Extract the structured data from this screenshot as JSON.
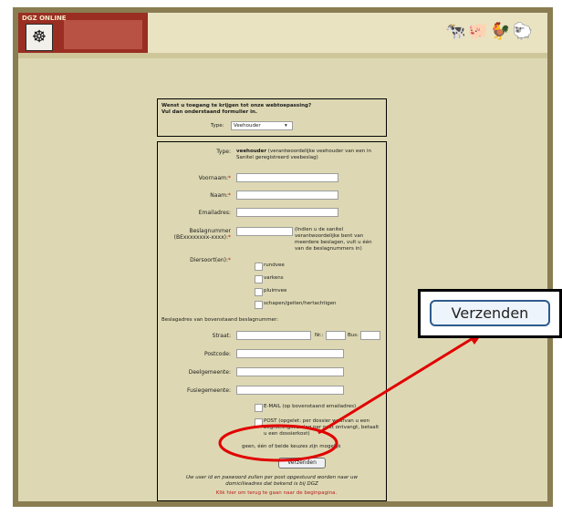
{
  "site": {
    "title": "DGZ ONLINE"
  },
  "intro": {
    "line1": "Wenst u toegang te krijgen tot onze webtoepassing?",
    "line2": "Vul dan onderstaand formulier in.",
    "type_label": "Type:",
    "type_value": "Veehouder"
  },
  "form": {
    "type_label": "Type:",
    "type_desc_bold": "veehouder",
    "type_desc": "(verantwoordelijke veehouder van een in Sanitel geregistreerd veebeslag)",
    "voornaam": "Voornaam:",
    "naam": "Naam:",
    "email": "Emailadres:",
    "beslagnummer": "Beslagnummer",
    "beslag_format": "(BExxxxxxxx-xxxx):",
    "beslag_hint": "(Indien u de sanitel verantwoordelijke bent van meerdere beslagen, vult u één van de beslagnummers in)",
    "diersoort": "Diersoort(en):",
    "species": [
      "rundvee",
      "varkens",
      "pluimvee",
      "schapen/geiten/hertachtigen"
    ],
    "address_heading": "Beslagadres van bovenstaand beslagnummer:",
    "straat": "Straat:",
    "nr": "Nr.:",
    "bus": "Bus:",
    "postcode": "Postcode:",
    "deelgemeente": "Deelgemeente:",
    "fusiegemeente": "Fusiegemeente:",
    "opt_email": "E-MAIL (op bovenstaand emailadres)",
    "opt_post": "POST (opgelet: per dossier waarvan u een begroeiingsverslag per post ontvangt, betaalt u een dossierkost)",
    "choice_note": "geen, één of beide keuzes zijn mogelijk",
    "submit": "Verzenden",
    "note": "Uw user id en paswoord zullen per post opgestuurd worden naar uw domicilieadres dat bekend is bij DGZ",
    "back_link": "Klik hier om terug te gaan naar de beginpagina."
  },
  "zoom": {
    "button": "Verzenden"
  },
  "colors": {
    "frame": "#8a7d52",
    "page": "#ddd8b3",
    "brand": "#9a2e22",
    "annotation": "#e10000"
  },
  "icons": {
    "logo": "dgz-logo-icon",
    "animals": "animals-banner-icon",
    "arrow": "red-arrow-icon",
    "circle": "red-circle-icon"
  }
}
